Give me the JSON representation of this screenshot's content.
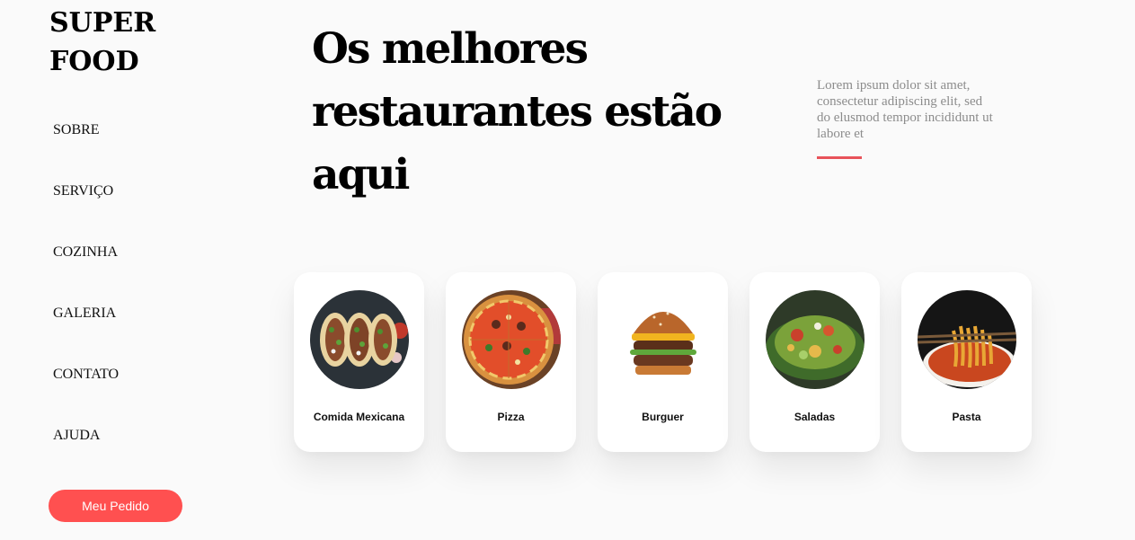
{
  "brand": {
    "line1": "SUPER",
    "line2": "FOOD"
  },
  "nav": {
    "items": [
      "SOBRE",
      "SERVIÇO",
      "COZINHA",
      "GALERIA",
      "CONTATO",
      "AJUDA"
    ]
  },
  "order_button": {
    "label": "Meu Pedido",
    "color": "#ff5050"
  },
  "hero": {
    "title": "Os melhores restaurantes estão aqui",
    "description": "Lorem ipsum dolor sit amet, consectetur adipiscing elit, sed do elusmod tempor incididunt ut labore et",
    "accent_color": "#e8535a"
  },
  "categories": [
    {
      "label": "Comida Mexicana",
      "image": "tacos-photo"
    },
    {
      "label": "Pizza",
      "image": "pizza-photo"
    },
    {
      "label": "Burguer",
      "image": "burger-photo"
    },
    {
      "label": "Saladas",
      "image": "salad-photo"
    },
    {
      "label": "Pasta",
      "image": "pasta-photo"
    }
  ]
}
